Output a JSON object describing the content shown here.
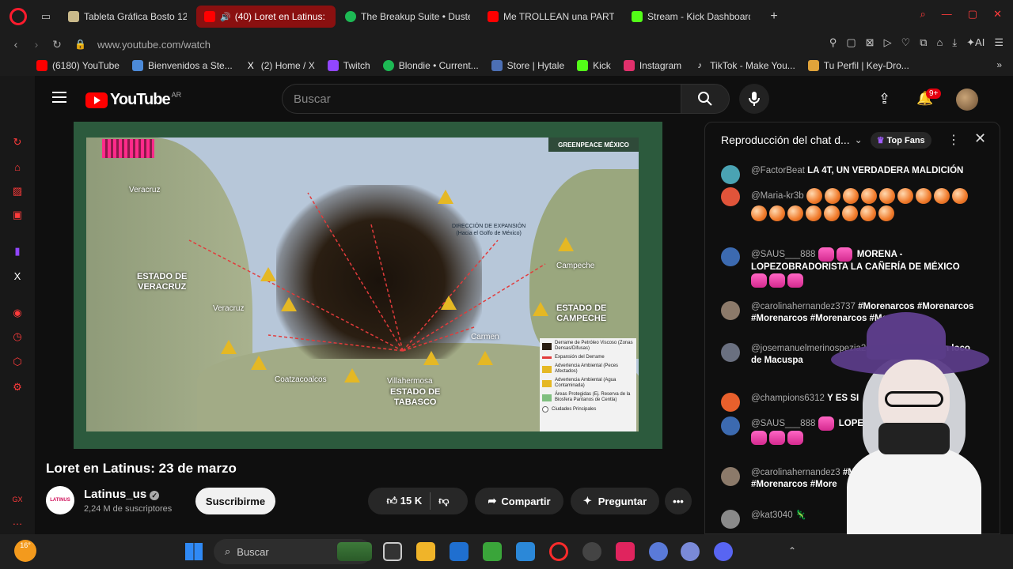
{
  "browser": {
    "tabs": [
      {
        "label": "Tableta Gráfica Bosto 12",
        "color": "#c9b98a"
      },
      {
        "label": "(40) Loret en Latinus:",
        "color": "#ff0000",
        "active": true
      },
      {
        "label": "The Breakup Suite • Duste",
        "color": "#1db954"
      },
      {
        "label": "Me TROLLEAN una PARTI",
        "color": "#ff0000"
      },
      {
        "label": "Stream - Kick Dashboard",
        "color": "#53fc18"
      }
    ],
    "url": "www.youtube.com/watch",
    "ai_label": "AI",
    "bookmarks": [
      {
        "label": "(6180) YouTube",
        "color": "#ff0000"
      },
      {
        "label": "Bienvenidos a Ste...",
        "color": "#4c8ad8"
      },
      {
        "label": "(2) Home / X",
        "color": "#ffffff"
      },
      {
        "label": "Twitch",
        "color": "#9146ff"
      },
      {
        "label": "Blondie • Current...",
        "color": "#1db954"
      },
      {
        "label": "Store | Hytale",
        "color": "#4c6fb4"
      },
      {
        "label": "Kick",
        "color": "#53fc18"
      },
      {
        "label": "Instagram",
        "color": "#e1306c"
      },
      {
        "label": "TikTok - Make You...",
        "color": "#ffffff"
      },
      {
        "label": "Tu Perfil | Key-Dro...",
        "color": "#e0a33a"
      }
    ]
  },
  "youtube": {
    "logo_text": "YouTube",
    "region": "AR",
    "search_placeholder": "Buscar",
    "notifications_badge": "9+",
    "video": {
      "title": "Loret en Latinus: 23 de marzo",
      "channel": "Latinus_us",
      "channel_avatar_text": "LATINUS",
      "subscribers": "2,24 M de suscriptores",
      "subscribe_label": "Suscribirme",
      "likes": "15 K",
      "share_label": "Compartir",
      "ask_label": "Preguntar"
    },
    "map": {
      "brand": "GREENPEACE MÉXICO",
      "labels": {
        "veracruz_top": "Veracruz",
        "estado_veracruz": "ESTADO DE\nVERACRUZ",
        "veracruz_mid": "Veracruz",
        "coatzacoalcos": "Coatzacoalcos",
        "villahermosa": "Villahermosa",
        "estado_tabasco": "ESTADO DE\nTABASCO",
        "carmen": "Carmen",
        "campeche": "Campeche",
        "estado_campeche": "ESTADO DE\nCAMPECHE",
        "expansion": "DIRECCIÓN DE EXPANSIÓN\n(Hacia el Golfo de México)"
      },
      "legend": [
        {
          "label": "Derrame de Petróleo Viscoso (Zonas Densas/Difusas)",
          "color": "#2a1e12"
        },
        {
          "label": "Expansión del Derrame",
          "color": "#e23b3b"
        },
        {
          "label": "Advertencia Ambiental (Peces Afectados)",
          "color": "#e5b824"
        },
        {
          "label": "Advertencia Ambiental (Agua Contaminada)",
          "color": "#e5b824"
        },
        {
          "label": "Áreas Protegidas (Ej. Reserva de la Biosfera Pantanos de Centla)",
          "color": "#7fbf7f"
        },
        {
          "label": "Ciudades Principales",
          "color": "#ffffff"
        }
      ]
    },
    "chat": {
      "title": "Reproducción del chat d...",
      "top_fans": "Top Fans",
      "messages": [
        {
          "author": "@FactorBeat",
          "text": "LA 4T, UN VERDADERA MALDICIÓN",
          "color": "#4aa3b3"
        },
        {
          "author": "@Maria-kr3b",
          "text": "",
          "color": "#e0543a"
        },
        {
          "author": "@SAUS___888",
          "text": "MORENA - LOPEZOBRADORISTA LA CAÑERÍA DE MÉXICO",
          "color": "#3c6ab0"
        },
        {
          "author": "@carolinahernandez3737",
          "text": "#Morenarcos #Morenarcos #Morenarcos #Morenarcos #Morenarcos",
          "color": "#8c7a6a"
        },
        {
          "author": "@josemanuelmerinospezia2",
          "text": "montajes debe ren loco de Macuspa",
          "color": "#6a7080"
        },
        {
          "author": "@champions6312",
          "text": "Y ES SI",
          "color": "#e8602c"
        },
        {
          "author": "@SAUS___888",
          "text": "LOPEZOBRADORISTA LA C",
          "color": "#3c6ab0"
        },
        {
          "author": "@carolinahernandez3",
          "text": "#Morenarcos #More #Morenarcos #More",
          "color": "#8c7a6a"
        },
        {
          "author": "@kat3040",
          "text": "",
          "color": "#8a8a8a"
        }
      ]
    }
  },
  "taskbar": {
    "temperature": "16°",
    "search_label": "Buscar"
  }
}
